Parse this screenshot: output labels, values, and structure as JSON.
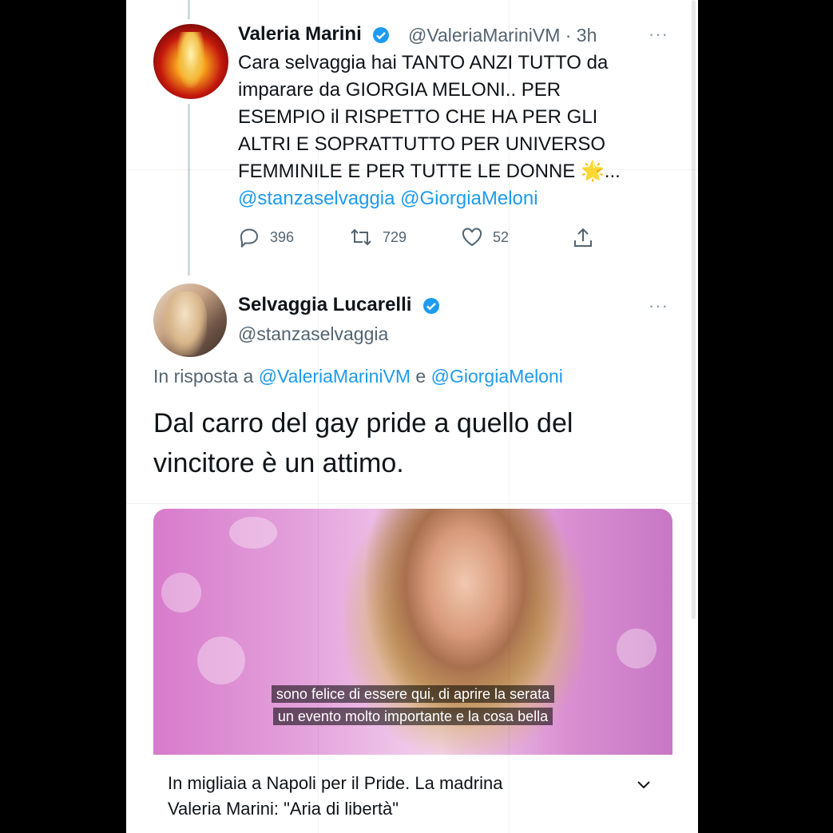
{
  "tweet1": {
    "name": "Valeria Marini",
    "handle": "@ValeriaMariniVM · 3h",
    "lines": [
      "Cara selvaggia hai TANTO ANZI TUTTO da",
      "imparare da GIORGIA MELONI.. PER",
      "ESEMPIO il RISPETTO CHE HA PER GLI",
      "ALTRI E SOPRATTUTTO  PER UNIVERSO",
      "FEMMINILE E PER TUTTE LE DONNE 🌟..."
    ],
    "mentions": "@stanzaselvaggia @GiorgiaMeloni",
    "replies": "396",
    "retweets": "729",
    "likes": "52",
    "more": "···"
  },
  "tweet2": {
    "name": "Selvaggia Lucarelli",
    "handle": "@stanzaselvaggia",
    "reply_prefix": "In risposta a ",
    "reply_user1": "@ValeriaMariniVM",
    "reply_and": " e ",
    "reply_user2": "@GiorgiaMeloni",
    "text_line1": "Dal carro del gay pride a quello del",
    "text_line2": "vincitore è un attimo.",
    "more": "···"
  },
  "video": {
    "subtitle_line1": "sono felice di essere qui, di aprire la serata",
    "subtitle_line2": "un evento molto importante e la cosa bella",
    "caption_line1": "In migliaia a Napoli per il Pride. La madrina",
    "caption_line2": "Valeria Marini: \"Aria di libertà\""
  },
  "colors": {
    "link": "#1d9bf0",
    "verified": "#1d9bf0",
    "text": "#0f1419",
    "secondary": "#536471"
  }
}
